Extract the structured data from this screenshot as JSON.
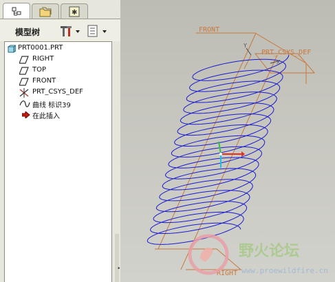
{
  "left_panel": {
    "tabs": [
      {
        "icon": "model-tree-icon",
        "active": true
      },
      {
        "icon": "folder-browser-icon",
        "active": false
      },
      {
        "icon": "favorites-icon",
        "active": false
      }
    ],
    "title": "模型树",
    "settings_icon": "tree-settings-icon",
    "show_icon": "tree-show-icon"
  },
  "tree": {
    "root": "PRT0001.PRT",
    "items": [
      {
        "label": "RIGHT",
        "icon": "datum-plane-icon"
      },
      {
        "label": "TOP",
        "icon": "datum-plane-icon"
      },
      {
        "label": "FRONT",
        "icon": "datum-plane-icon"
      },
      {
        "label": "PRT_CSYS_DEF",
        "icon": "coordinate-system-icon"
      },
      {
        "label": "曲线 标识39",
        "icon": "curve-icon"
      },
      {
        "label": "在此插入",
        "icon": "insert-here-arrow-icon"
      }
    ]
  },
  "viewport": {
    "labels": {
      "front": "FRONT",
      "csys": "PRT_CSYS_DEF",
      "right": "RIGHT",
      "axis_y": "Y",
      "axis_x": "X"
    },
    "colors": {
      "datum": "#c8783c",
      "helix": "#1a1ad0",
      "csys_x": "#e03020",
      "csys_y": "#20c0e0",
      "csys_z": "#30c040"
    },
    "watermark": {
      "title": "野火论坛",
      "url": "www.proewildfire.cn"
    }
  }
}
